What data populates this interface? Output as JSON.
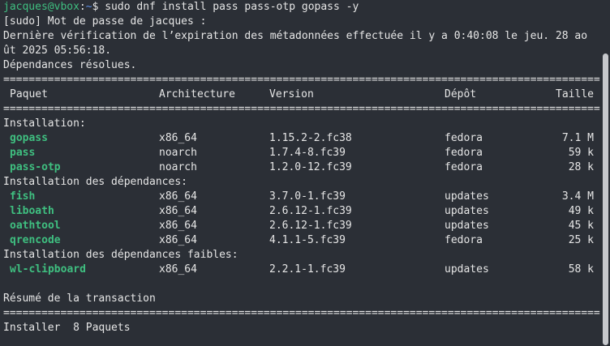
{
  "prompt": {
    "user_host": "jacques@vbox",
    "separator": ":",
    "path": "~",
    "symbol": "$ ",
    "command": "sudo dnf install pass pass-otp gopass -y"
  },
  "output": {
    "sudo_prompt": "[sudo] Mot de passe de jacques :",
    "metadata_line1": "Dernière vérification de l’expiration des métadonnées effectuée il y a 0:40:08 le jeu. 28 ao",
    "metadata_line2": "ût 2025 05:56:18.",
    "deps_resolved": "Dépendances résolues.",
    "rule_double": "==========================================================================================================================",
    "headers": {
      "package": "Paquet",
      "arch": "Architecture",
      "version": "Version",
      "repo": "Dépôt",
      "size": "Taille"
    },
    "section_install": "Installation:",
    "section_deps": "Installation des dépendances:",
    "section_weak": "Installation des dépendances faibles:",
    "install": [
      {
        "name": "gopass",
        "arch": "x86_64",
        "version": "1.15.2-2.fc38",
        "repo": "fedora",
        "size": "7.1 M"
      },
      {
        "name": "pass",
        "arch": "noarch",
        "version": "1.7.4-8.fc39",
        "repo": "fedora",
        "size": "59 k"
      },
      {
        "name": "pass-otp",
        "arch": "noarch",
        "version": "1.2.0-12.fc39",
        "repo": "fedora",
        "size": "28 k"
      }
    ],
    "deps": [
      {
        "name": "fish",
        "arch": "x86_64",
        "version": "3.7.0-1.fc39",
        "repo": "updates",
        "size": "3.4 M"
      },
      {
        "name": "liboath",
        "arch": "x86_64",
        "version": "2.6.12-1.fc39",
        "repo": "updates",
        "size": "49 k"
      },
      {
        "name": "oathtool",
        "arch": "x86_64",
        "version": "2.6.12-1.fc39",
        "repo": "updates",
        "size": "45 k"
      },
      {
        "name": "qrencode",
        "arch": "x86_64",
        "version": "4.1.1-5.fc39",
        "repo": "fedora",
        "size": "25 k"
      }
    ],
    "weak": [
      {
        "name": "wl-clipboard",
        "arch": "x86_64",
        "version": "2.2.1-1.fc39",
        "repo": "updates",
        "size": "58 k"
      }
    ],
    "summary_title": "Résumé de la transaction",
    "summary_install": "Installer  8 Paquets"
  },
  "colors": {
    "background": "#2b2f36",
    "text": "#e6e6e6",
    "accent_green": "#3fbf80",
    "path_blue": "#5c8ee6"
  }
}
